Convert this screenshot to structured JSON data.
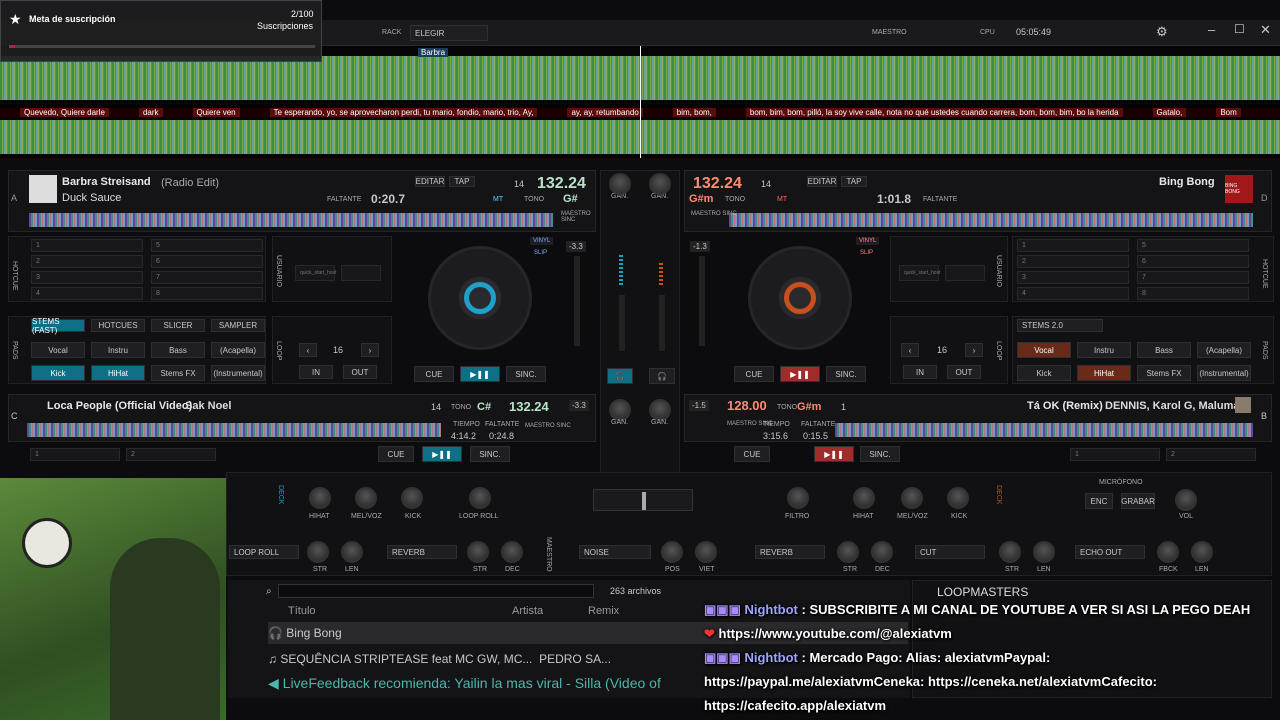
{
  "overlay": {
    "title": "Meta de suscripción",
    "count": "2/100",
    "sub": "Suscripciones"
  },
  "topbar": {
    "rack": "RACK",
    "rack_select": "ELEGIR",
    "master": "MAESTRO",
    "cpu": "CPU",
    "time": "05:05:49"
  },
  "wave": {
    "marker": "Barbra",
    "lyrics": [
      "Quevedo, Quiere darle",
      "dark",
      "Quiere ven",
      "Te esperando, yo, se aprovecharon perdi, tu mario, fondio, mario, trio, Ay,",
      "ay, ay, retumbando",
      "bim, bom,",
      "bom, bim, bom, pilló, la soy vive calle, nota no qué ustedes cuando carrera, bom, bom, bim, bo la herida",
      "Gatalo,",
      "Bom"
    ]
  },
  "deckA": {
    "title": "Barbra Streisand",
    "subtitle": "(Radio Edit)",
    "artist": "Duck Sauce",
    "remaining_lbl": "FALTANTE",
    "remaining": "0:20.7",
    "edit": "EDITAR",
    "tap": "TAP",
    "key_num": "14",
    "bpm": "132.24",
    "mt": "MT",
    "tono": "TONO",
    "key": "G#",
    "sync_lbl": "MAESTRO SINC",
    "pitch": "-3.3",
    "letter": "A",
    "vinyl": "VINYL",
    "slip": "SLIP"
  },
  "deckD": {
    "title": "Bing Bong",
    "bpm": "132.24",
    "key_num": "14",
    "key": "G#m",
    "tono": "TONO",
    "mt": "MT",
    "edit": "EDITAR",
    "tap": "TAP",
    "remaining": "1:01.8",
    "remaining_lbl": "FALTANTE",
    "sync_lbl": "MAESTRO SINC",
    "pitch": "-1.3",
    "letter": "D",
    "badge": "BING BONG",
    "vinyl": "VINYL",
    "slip": "SLIP"
  },
  "hotcues": {
    "left": [
      "1",
      "2",
      "3",
      "4",
      "5",
      "6",
      "7",
      "8"
    ],
    "right": [
      "1",
      "2",
      "3",
      "4",
      "5",
      "6",
      "7",
      "8"
    ],
    "side": "HOTCUE",
    "sampler": "USUARIO",
    "slot": "quick_start_host"
  },
  "padsA": {
    "tabs": [
      "STEMS (FAST)",
      "HOTCUES",
      "SLICER",
      "SAMPLER"
    ],
    "pads": [
      "Vocal",
      "Instru",
      "Bass",
      "(Acapella)",
      "Kick",
      "HiHat",
      "Stems FX",
      "(Instrumental)"
    ],
    "side": "PADS",
    "loop_lbl": "LOOP",
    "loop": "16",
    "in": "IN",
    "out": "OUT",
    "cue": "CUE",
    "sync": "SINC."
  },
  "padsD": {
    "tab": "STEMS 2.0",
    "pads": [
      "Vocal",
      "Instru",
      "Bass",
      "(Acapella)",
      "Kick",
      "HiHat",
      "Stems FX",
      "(Instrumental)"
    ],
    "side": "PADS",
    "loop_lbl": "LOOP",
    "loop": "16",
    "in": "IN",
    "out": "OUT",
    "cue": "CUE",
    "sync": "SINC."
  },
  "mixer": {
    "gain": "GAN."
  },
  "deckC": {
    "title": "Loca People (Official Video)",
    "artist": "Sak Noel",
    "key_num": "14",
    "tono": "TONO",
    "key": "C#",
    "bpm": "132.24",
    "pitch": "-3.3",
    "tiempo": "TIEMPO",
    "tiempo_v": "4:14.2",
    "faltante": "FALTANTE",
    "faltante_v": "0:24.8",
    "sync_lbl": "MAESTRO SINC",
    "letter": "C",
    "cue": "CUE",
    "sync": "SINC.",
    "hc": [
      "1",
      "2"
    ]
  },
  "deckB": {
    "title": "Tá OK (Remix)",
    "artist": "DENNIS, Karol G, Maluma",
    "bpm": "128.00",
    "tono": "TONO",
    "key": "G#m",
    "num": "1",
    "pitch": "-1.5",
    "tiempo": "TIEMPO",
    "tiempo_v": "3:15.6",
    "faltante": "FALTANTE",
    "faltante_v": "0:15.5",
    "sync_lbl": "MAESTRO SINC",
    "letter": "B",
    "cue": "CUE",
    "sync": "SINC.",
    "hc": [
      "1",
      "2"
    ]
  },
  "fx": {
    "left": [
      "HIHAT",
      "MEL/VOZ",
      "KICK",
      "LOOP ROLL"
    ],
    "left_drops": [
      "LOOP ROLL",
      "REVERB"
    ],
    "center_drop": "NOISE",
    "pos": "POS",
    "vinyl": "VIEt",
    "right": [
      "FILTRO",
      "HIHAT",
      "MEL/VOZ",
      "KICK"
    ],
    "right_drops": [
      "REVERB",
      "CUT",
      "ECHO OUT"
    ],
    "str": "STR",
    "len": "LEN",
    "dec": "DEC",
    "fbck": "FBCK",
    "mic": "MICRÓFONO",
    "enc": "ENC",
    "grabar": "GRABAR",
    "vol": "VOL",
    "maestro": "MAESTRO",
    "deck": "DECK"
  },
  "browser": {
    "count": "263 archivos",
    "cols": [
      "Título",
      "Artista",
      "Remix"
    ],
    "rows": [
      {
        "title": "Bing Bong",
        "artist": ""
      },
      {
        "title": "SEQUÊNCIA STRIPTEASE feat MC GW, MC...",
        "artist": "PEDRO SA..."
      }
    ],
    "live": "LiveFeedback recomienda: Yailin la mas viral - Silla (Video of",
    "side": "LOOPMASTERS"
  },
  "chat": [
    {
      "user": "Nightbot",
      "msg": ": SUBSCRIBITE A MI CANAL DE YOUTUBE A VER SI ASI LA PEGO DEAH",
      "link": "https://www.youtube.com/@alexiatvm"
    },
    {
      "user": "Nightbot",
      "msg": ": Mercado Pago: Alias: alexiatvmPaypal: https://paypal.me/alexiatvmCeneka: https://ceneka.net/alexiatvmCafecito: https://cafecito.app/alexiatvm"
    }
  ]
}
